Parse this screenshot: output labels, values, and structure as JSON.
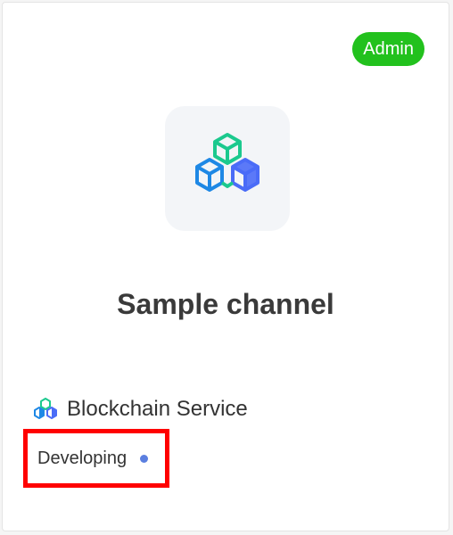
{
  "card": {
    "badge": "Admin",
    "logo_icon": "blockchain-cubes-icon",
    "title": "Sample channel",
    "service": {
      "icon": "blockchain-cubes-icon",
      "label": "Blockchain Service"
    },
    "status": {
      "label": "Developing",
      "dot_color": "#5b7fe0"
    }
  },
  "colors": {
    "badge_bg": "#22c11d",
    "title": "#3a3a3a",
    "highlight_border": "#ff0000",
    "cube_green": "#1bc98e",
    "cube_blue": "#1e88e5",
    "cube_indigo": "#4a6cf7"
  }
}
